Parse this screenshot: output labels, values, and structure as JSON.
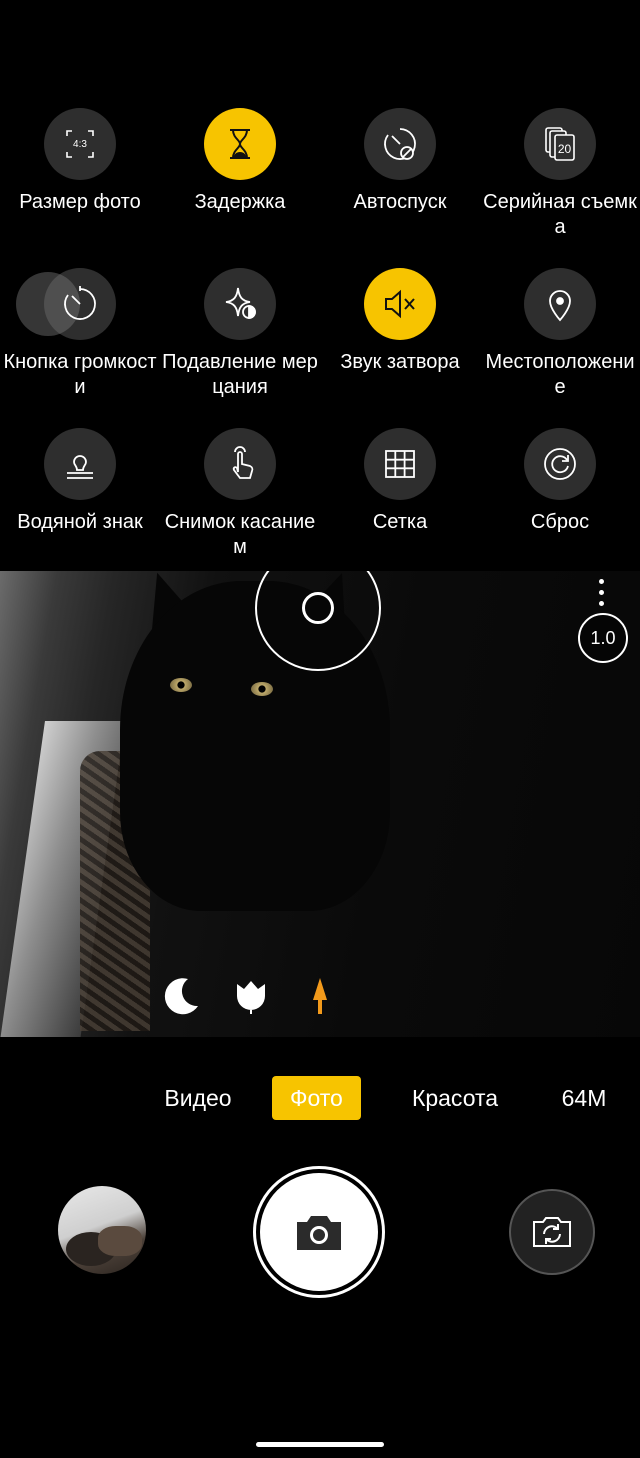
{
  "settings": {
    "items": [
      {
        "label": "Размер фото",
        "icon": "aspect-ratio-icon",
        "badge": "4:3",
        "active": false
      },
      {
        "label": "Задержка",
        "icon": "hourglass-icon",
        "active": true
      },
      {
        "label": "Автоспуск",
        "icon": "self-timer-off-icon",
        "active": false
      },
      {
        "label": "Серийная съемка",
        "icon": "burst-icon",
        "badge": "20",
        "active": false
      },
      {
        "label": "Кнопка громкости",
        "icon": "volume-key-icon",
        "active": false
      },
      {
        "label": "Подавление мерцания",
        "icon": "anti-flicker-icon",
        "active": false
      },
      {
        "label": "Звук затвора",
        "icon": "mute-icon",
        "active": true
      },
      {
        "label": "Местоположение",
        "icon": "location-pin-icon",
        "active": false
      },
      {
        "label": "Водяной знак",
        "icon": "watermark-icon",
        "active": false
      },
      {
        "label": "Снимок касанием",
        "icon": "touch-capture-icon",
        "active": false
      },
      {
        "label": "Сетка",
        "icon": "grid-icon",
        "active": false
      },
      {
        "label": "Сброс",
        "icon": "reset-icon",
        "active": false
      }
    ]
  },
  "viewfinder": {
    "zoom": "1.0",
    "scene_icons": [
      "night-icon",
      "macro-icon",
      "bokeh-icon"
    ]
  },
  "modes": {
    "items": [
      {
        "label": "Видео",
        "active": false
      },
      {
        "label": "Фото",
        "active": true
      },
      {
        "label": "Красота",
        "active": false
      },
      {
        "label": "64M",
        "active": false
      }
    ]
  },
  "colors": {
    "accent": "#f7c400",
    "icon_circle": "#2e2e2e",
    "bokeh": "#f39a1b"
  }
}
